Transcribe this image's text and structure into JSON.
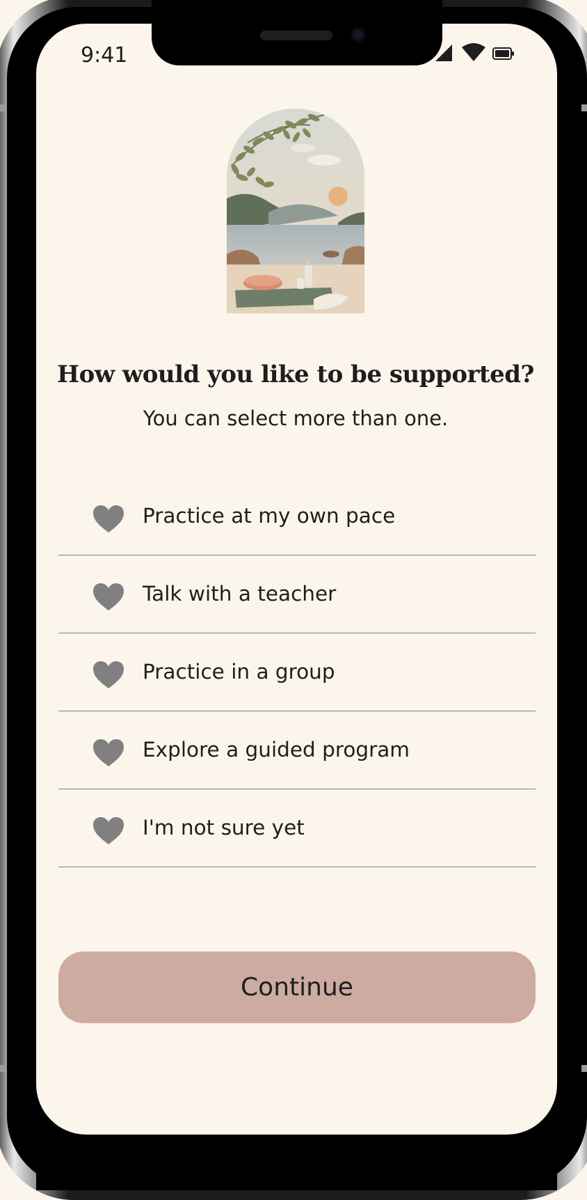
{
  "status_bar": {
    "time": "9:41",
    "icons": [
      "cellular-signal-icon",
      "wifi-icon",
      "battery-icon"
    ]
  },
  "hero": {
    "icon": "lakeside-meditation-illustration"
  },
  "header": {
    "title": "How would you like to be supported?",
    "subtitle": "You can select more than one."
  },
  "options": [
    {
      "label": "Practice at my own pace",
      "icon": "heart-icon",
      "selected": false
    },
    {
      "label": "Talk with a teacher",
      "icon": "heart-icon",
      "selected": false
    },
    {
      "label": "Practice in a group",
      "icon": "heart-icon",
      "selected": false
    },
    {
      "label": "Explore a guided program",
      "icon": "heart-icon",
      "selected": false
    },
    {
      "label": "I'm not sure yet",
      "icon": "heart-icon",
      "selected": false
    }
  ],
  "footer": {
    "continue_label": "Continue"
  },
  "colors": {
    "background": "#fbf5eb",
    "button": "#cdaba0",
    "heart": "#808080",
    "text": "#1e1e1e",
    "divider": "#7f817c"
  }
}
